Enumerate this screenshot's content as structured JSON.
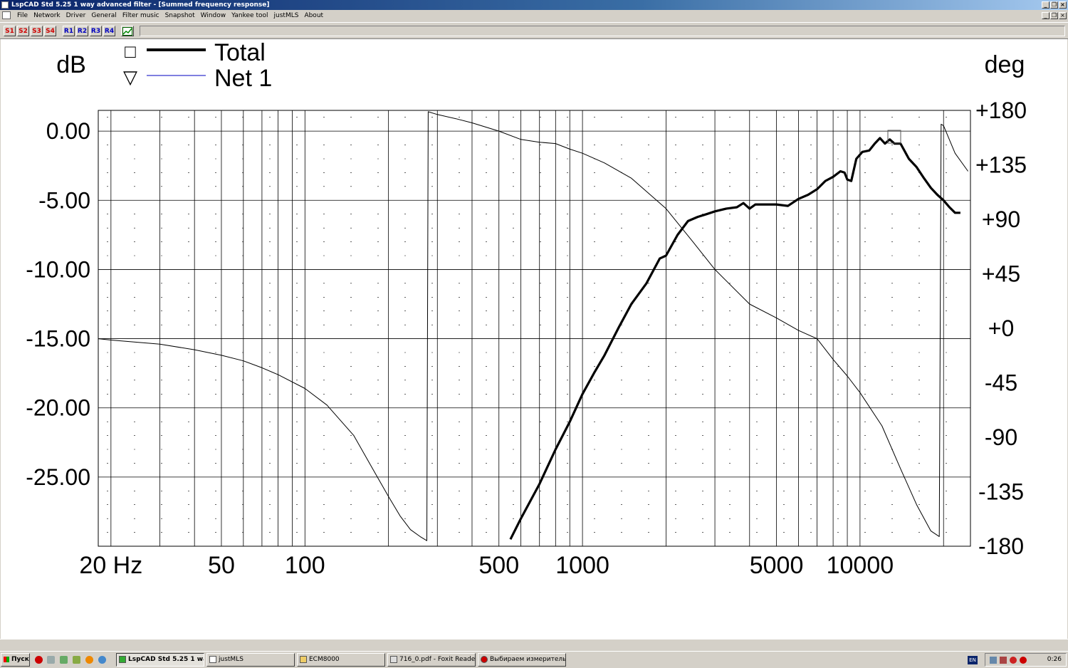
{
  "window": {
    "title": "LspCAD Std 5.25 1 way advanced filter - [Summed frequency response]"
  },
  "menu": [
    "File",
    "Network",
    "Driver",
    "General",
    "Filter music",
    "Snapshot",
    "Window",
    "Yankee tool",
    "justMLS",
    "About"
  ],
  "toolbar": {
    "snapshot_buttons": [
      "S1",
      "S2",
      "S3",
      "S4"
    ],
    "recall_buttons": [
      "R1",
      "R2",
      "R3",
      "R4"
    ]
  },
  "chart_data": {
    "type": "line",
    "left_axis_label": "dB",
    "right_axis_label": "deg",
    "x_scale": "log",
    "xlim": [
      18,
      25000
    ],
    "x_tick_labels": [
      "20 Hz",
      "50",
      "100",
      "500",
      "1000",
      "5000",
      "10000"
    ],
    "ylim": [
      -30,
      1.5
    ],
    "y_tick_labels": [
      "0.00",
      "-5.00",
      "-10.00",
      "-15.00",
      "-20.00",
      "-25.00"
    ],
    "y2lim": [
      -180,
      180
    ],
    "y2_tick_labels": [
      "+180",
      "+135",
      "+90",
      "+45",
      "+0",
      "-45",
      "-90",
      "-135",
      "-180"
    ],
    "legend": [
      {
        "name": "Total",
        "marker": "□",
        "color": "#000000"
      },
      {
        "name": "Net 1",
        "marker": "▽",
        "color": "#0000c0"
      }
    ],
    "series": [
      {
        "name": "Total",
        "axis": "dB",
        "color": "#000000",
        "x": [
          550,
          600,
          700,
          800,
          900,
          1000,
          1100,
          1200,
          1350,
          1500,
          1700,
          1900,
          2000,
          2200,
          2400,
          2600,
          2800,
          3000,
          3300,
          3600,
          3800,
          4000,
          4200,
          4500,
          5000,
          5500,
          6000,
          6500,
          7000,
          7500,
          8000,
          8500,
          8800,
          9000,
          9300,
          9700,
          10200,
          10800,
          11300,
          11800,
          12300,
          12800,
          13300,
          14000,
          15000,
          16000,
          17000,
          18000,
          19000,
          20000,
          21000,
          22000,
          23000
        ],
        "y": [
          -29.5,
          -28.0,
          -25.5,
          -23.0,
          -21.0,
          -19.0,
          -17.5,
          -16.2,
          -14.2,
          -12.5,
          -11.0,
          -9.2,
          -9.0,
          -7.5,
          -6.5,
          -6.2,
          -6.0,
          -5.8,
          -5.6,
          -5.5,
          -5.2,
          -5.6,
          -5.3,
          -5.3,
          -5.3,
          -5.4,
          -4.9,
          -4.6,
          -4.2,
          -3.6,
          -3.3,
          -2.9,
          -3.0,
          -3.5,
          -3.6,
          -2.0,
          -1.5,
          -1.4,
          -0.9,
          -0.5,
          -0.9,
          -0.6,
          -0.9,
          -0.9,
          -2.0,
          -2.6,
          -3.4,
          -4.1,
          -4.6,
          -5.0,
          -5.5,
          -5.9,
          -5.9
        ]
      },
      {
        "name": "Net 1",
        "axis": "deg",
        "color": "#000000",
        "x": [
          18,
          20,
          30,
          40,
          50,
          60,
          70,
          80,
          100,
          120,
          150,
          180,
          200,
          220,
          240,
          260,
          275,
          278,
          300,
          350,
          400,
          500,
          600,
          700,
          800,
          900,
          1000,
          1200,
          1500,
          2000,
          2500,
          3000,
          4000,
          5000,
          6000,
          7000,
          8000,
          9000,
          10000,
          12000,
          14000,
          16000,
          18000,
          19300,
          19600,
          20000,
          22000,
          24500
        ],
        "y": [
          -15.0,
          -15.1,
          -15.4,
          -15.8,
          -16.2,
          -16.6,
          -17.1,
          -17.6,
          -18.6,
          -19.8,
          -22.0,
          -24.8,
          -26.4,
          -27.8,
          -28.8,
          -29.3,
          -29.6,
          1.4,
          1.2,
          0.9,
          0.6,
          0.0,
          -0.6,
          -0.8,
          -0.9,
          -1.3,
          -1.6,
          -2.3,
          -3.4,
          -5.6,
          -8.0,
          -10.0,
          -12.5,
          -13.5,
          -14.4,
          -15.0,
          -16.5,
          -17.7,
          -18.9,
          -21.3,
          -24.4,
          -27.0,
          -28.9,
          -29.3,
          0.5,
          0.4,
          -1.6,
          -2.9
        ]
      }
    ]
  },
  "taskbar": {
    "start_label": "Пуск",
    "tasks": [
      "LspCAD Std 5.25 1 wa...",
      "justMLS",
      "ECM8000",
      "716_0.pdf - Foxit Reade...",
      "Выбираем измерительн..."
    ],
    "language": "EN",
    "clock": "0:26"
  }
}
